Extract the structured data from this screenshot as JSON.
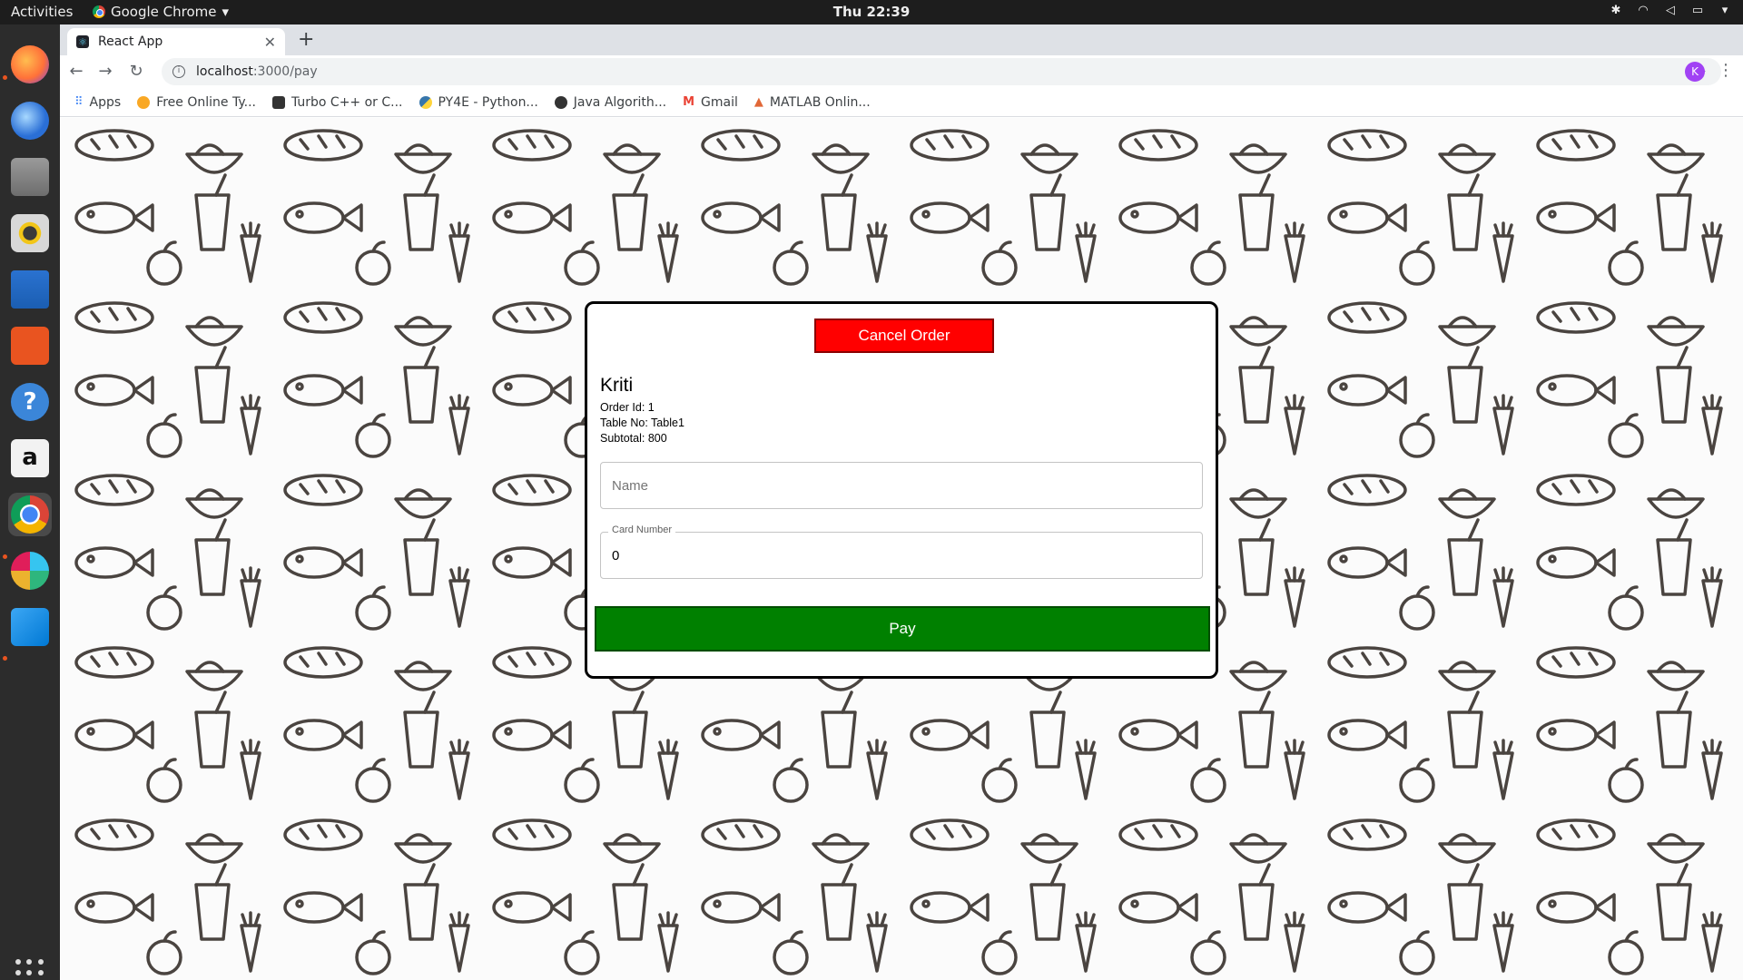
{
  "topbar": {
    "activities": "Activities",
    "app_name": "Google Chrome",
    "clock": "Thu 22:39"
  },
  "dock": {
    "items": [
      {
        "name": "firefox",
        "color": "#ff7139"
      },
      {
        "name": "thunderbird",
        "color": "#2a6fd6"
      },
      {
        "name": "files",
        "color": "#8a8a8a"
      },
      {
        "name": "rhythmbox",
        "color": "#f2c618"
      },
      {
        "name": "libreoffice-writer",
        "color": "#2a72d0"
      },
      {
        "name": "ubuntu-software",
        "color": "#e95420"
      },
      {
        "name": "help",
        "color": "#3b86d9"
      },
      {
        "name": "amazon",
        "color": "#f2f2f2"
      },
      {
        "name": "chrome",
        "color": "#4285f4"
      },
      {
        "name": "slack",
        "color": "#ffffff"
      },
      {
        "name": "vscode",
        "color": "#0078d4"
      }
    ]
  },
  "browser": {
    "tab_title": "React App",
    "url_host": "localhost",
    "url_path": ":3000/pay",
    "profile_initial": "K",
    "bookmarks": [
      {
        "label": "Apps",
        "color": "#4285f4"
      },
      {
        "label": "Free Online Ty...",
        "color": "#f9a825"
      },
      {
        "label": "Turbo C++ or C...",
        "color": "#333333"
      },
      {
        "label": "PY4E - Python...",
        "color": "#3776ab"
      },
      {
        "label": "Java Algorith...",
        "color": "#333333"
      },
      {
        "label": "Gmail",
        "color": "#ea4335"
      },
      {
        "label": "MATLAB Onlin...",
        "color": "#e16737"
      }
    ]
  },
  "payment": {
    "cancel_label": "Cancel Order",
    "customer_name": "Kriti",
    "order_id": "Order Id: 1",
    "table_no": "Table No: Table1",
    "subtotal": "Subtotal: 800",
    "name_placeholder": "Name",
    "card_label": "Card Number",
    "card_value": "0",
    "pay_label": "Pay",
    "colors": {
      "cancel": "#ff0000",
      "pay": "#008000"
    }
  }
}
